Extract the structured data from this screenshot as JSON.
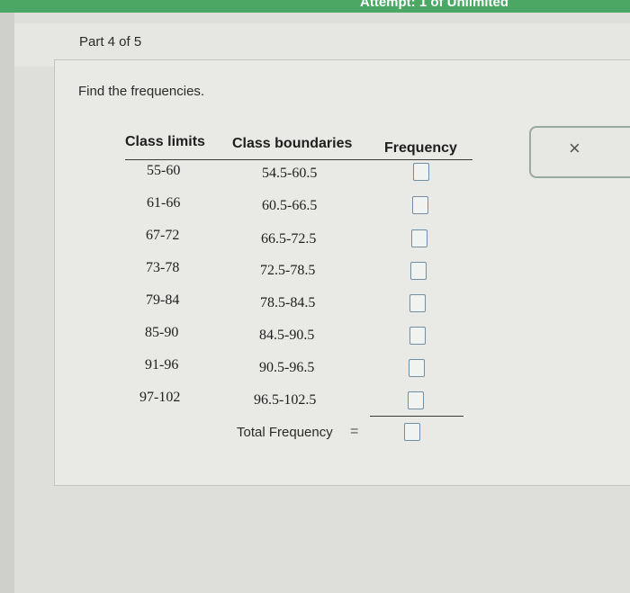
{
  "header": {
    "attempt_text": "Attempt: 1 of Unlimited"
  },
  "part": {
    "label": "Part 4 of 5"
  },
  "question": {
    "instruction": "Find the frequencies."
  },
  "table": {
    "columns": [
      "Class limits",
      "Class boundaries",
      "Frequency"
    ],
    "rows": [
      {
        "limits": "55-60",
        "boundaries": "54.5-60.5",
        "frequency": ""
      },
      {
        "limits": "61-66",
        "boundaries": "60.5-66.5",
        "frequency": ""
      },
      {
        "limits": "67-72",
        "boundaries": "66.5-72.5",
        "frequency": ""
      },
      {
        "limits": "73-78",
        "boundaries": "72.5-78.5",
        "frequency": ""
      },
      {
        "limits": "79-84",
        "boundaries": "78.5-84.5",
        "frequency": ""
      },
      {
        "limits": "85-90",
        "boundaries": "84.5-90.5",
        "frequency": ""
      },
      {
        "limits": "91-96",
        "boundaries": "90.5-96.5",
        "frequency": ""
      },
      {
        "limits": "97-102",
        "boundaries": "96.5-102.5",
        "frequency": ""
      }
    ],
    "total_label": "Total Frequency",
    "equals": "=",
    "total_value": ""
  },
  "actions": {
    "close_icon": "×"
  }
}
